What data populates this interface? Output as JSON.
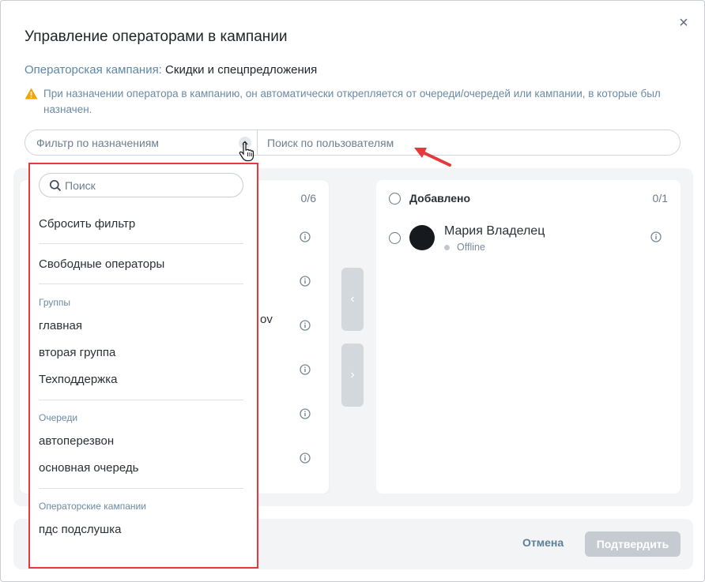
{
  "modal": {
    "title": "Управление операторами в кампании",
    "close_label": "×",
    "campaign_label": "Операторская кампания:",
    "campaign_value": "Скидки и спецпредложения",
    "warning_text": "При назначении оператора в кампанию, он автоматически открепляется от очереди/очередей или кампании, в которые был назначен.",
    "filter_placeholder": "Фильтр по назначениям",
    "search_placeholder": "Поиск по пользователям"
  },
  "left_panel": {
    "count": "0/6",
    "partial_text": "ov"
  },
  "right_panel": {
    "header_label": "Добавлено",
    "count": "0/1",
    "operator": {
      "name": "Мария Владелец",
      "status": "Offline"
    }
  },
  "buttons": {
    "move_left": "‹",
    "move_right": "›",
    "cancel": "Отмена",
    "confirm": "Подтвердить"
  },
  "dropdown": {
    "search_placeholder": "Поиск",
    "reset": "Сбросить фильтр",
    "free_operators": "Свободные операторы",
    "groups_title": "Группы",
    "groups": [
      "главная",
      "вторая группа",
      "Техподдержка"
    ],
    "queues_title": "Очереди",
    "queues": [
      "автоперезвон",
      "основная очередь"
    ],
    "campaigns_title": "Операторские кампании",
    "campaigns": [
      "пдс подслушка"
    ]
  },
  "colors": {
    "accent": "#5e87a6",
    "warning": "#f0a500",
    "highlight_border": "#e5393b",
    "disabled_button": "#c5cbd1"
  }
}
